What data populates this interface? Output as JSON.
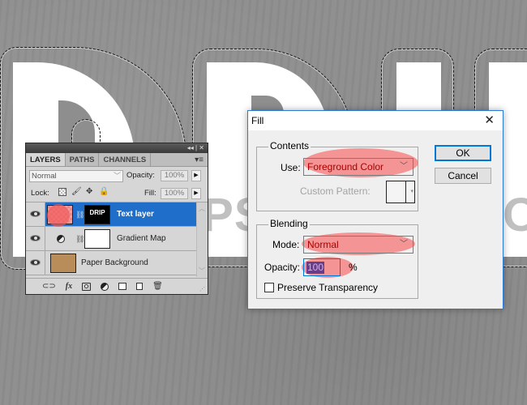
{
  "canvas": {
    "artwork_text": "DRIP",
    "watermark": "WWW.PSD-DUDE.COM"
  },
  "layers_panel": {
    "collapse_icon": "double-chevron-left",
    "close_icon": "x",
    "tabs": [
      {
        "label": "LAYERS",
        "active": true
      },
      {
        "label": "PATHS",
        "active": false
      },
      {
        "label": "CHANNELS",
        "active": false
      }
    ],
    "menu_icon": "panel-menu",
    "blend_mode": "Normal",
    "opacity_label": "Opacity:",
    "opacity_value": "100%",
    "lock_label": "Lock:",
    "lock_icons": [
      "lock-transparent-pixels",
      "lock-image-pixels",
      "lock-position",
      "lock-all"
    ],
    "fill_label": "Fill:",
    "fill_value": "100%",
    "layers": [
      {
        "name": "Text layer",
        "selected": true,
        "visible": true,
        "mask_text": "DRIP"
      },
      {
        "name": "Gradient Map",
        "selected": false,
        "visible": true
      },
      {
        "name": "Paper Background",
        "selected": false,
        "visible": true
      }
    ],
    "footer_icons": [
      "link-layers",
      "layer-style-fx",
      "add-mask",
      "new-adjustment-layer",
      "new-group",
      "new-layer",
      "delete-layer"
    ]
  },
  "fill_dialog": {
    "title": "Fill",
    "contents_label": "Contents",
    "use_label": "Use:",
    "use_value": "Foreground Color",
    "custom_pattern_label": "Custom Pattern:",
    "blending_label": "Blending",
    "mode_label": "Mode:",
    "mode_value": "Normal",
    "opacity_label": "Opacity:",
    "opacity_value": "100",
    "opacity_unit": "%",
    "preserve_transparency_label": "Preserve Transparency",
    "preserve_transparency_checked": false,
    "ok_label": "OK",
    "cancel_label": "Cancel"
  },
  "colors": {
    "highlight": "#f86e6e",
    "selected_layer": "#1f6ec9",
    "dialog_border": "#2b7bd6"
  }
}
